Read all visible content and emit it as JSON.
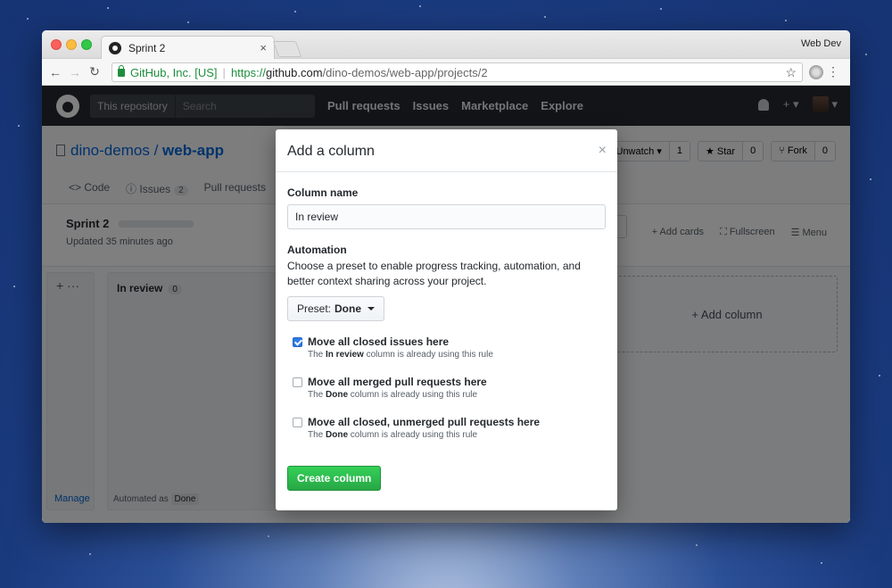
{
  "browser": {
    "tab_title": "Sprint 2",
    "tab_close": "×",
    "profile": "Web Dev",
    "org_label": "GitHub, Inc. [US]",
    "url_scheme": "https://",
    "url_host": "github.com",
    "url_path": "/dino-demos/web-app/projects/2",
    "back_glyph": "←",
    "forward_glyph": "→",
    "reload_glyph": "↻",
    "star_glyph": "☆",
    "menu_glyph": "⋮"
  },
  "github_header": {
    "scope_label": "This repository",
    "search_placeholder": "Search",
    "nav": [
      "Pull requests",
      "Issues",
      "Marketplace",
      "Explore"
    ],
    "plus_glyph": "+ ▾",
    "avatar_caret": "▾"
  },
  "repo": {
    "owner": "dino-demos",
    "slash": "/",
    "name": "web-app",
    "watch_label": "Unwatch ▾",
    "watch_count": "1",
    "star_label": "★ Star",
    "star_count": "0",
    "fork_label": "⑂ Fork",
    "fork_count": "0",
    "tabs": {
      "code": "<> Code",
      "issues": "ⓘ Issues",
      "issues_count": "2",
      "pulls": "Pull requests"
    }
  },
  "project": {
    "name": "Sprint 2",
    "updated": "Updated 35 minutes ago",
    "add_cards": "+ Add cards",
    "fullscreen": "⛶ Fullscreen",
    "menu": "☰ Menu"
  },
  "board": {
    "side_tools": "+  ···",
    "manage": "Manage",
    "column_title": "In review",
    "column_count": "0",
    "automated_as": "Automated as",
    "automated_value": "Done",
    "add_column": "+ Add column"
  },
  "modal": {
    "title": "Add a column",
    "close": "×",
    "column_name_label": "Column name",
    "column_name_value": "In review",
    "automation_label": "Automation",
    "automation_desc": "Choose a preset to enable progress tracking, automation, and better context sharing across your project.",
    "preset_prefix": "Preset:",
    "preset_value": "Done",
    "rules": [
      {
        "title": "Move all closed issues here",
        "note_pre": "The",
        "note_col": "In review",
        "note_post": "column is already using this rule",
        "checked": true
      },
      {
        "title": "Move all merged pull requests here",
        "note_pre": "The",
        "note_col": "Done",
        "note_post": "column is already using this rule",
        "checked": false
      },
      {
        "title": "Move all closed, unmerged pull requests here",
        "note_pre": "The",
        "note_col": "Done",
        "note_post": "column is already using this rule",
        "checked": false
      }
    ],
    "create_button": "Create column"
  }
}
